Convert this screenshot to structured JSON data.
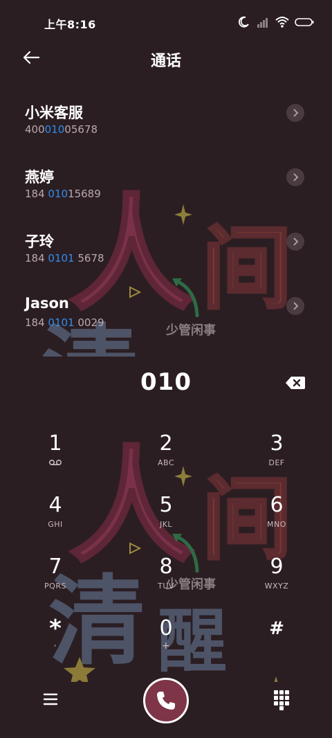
{
  "status_bar": {
    "time": "上午8:16",
    "icons": [
      "moon-icon",
      "signal-icon",
      "wifi-icon",
      "battery-icon"
    ]
  },
  "header": {
    "title": "通话",
    "back_icon": "back-arrow-icon"
  },
  "contacts": [
    {
      "name": "小米客服",
      "number_pre": "400",
      "number_match": "010",
      "number_post": "05678"
    },
    {
      "name": "燕婷",
      "number_pre": "184 ",
      "number_match": "010",
      "number_post": "15689"
    },
    {
      "name": "子玲",
      "number_pre": "184 ",
      "number_match": "0101",
      "number_post": " 5678"
    },
    {
      "name": "Jason",
      "number_pre": "184 ",
      "number_match": "0101",
      "number_post": " 0029"
    }
  ],
  "dialed_number": "010",
  "keypad": [
    {
      "digit": "1",
      "letters": ""
    },
    {
      "digit": "2",
      "letters": "ABC"
    },
    {
      "digit": "3",
      "letters": "DEF"
    },
    {
      "digit": "4",
      "letters": "GHI"
    },
    {
      "digit": "5",
      "letters": "JKL"
    },
    {
      "digit": "6",
      "letters": "MNO"
    },
    {
      "digit": "7",
      "letters": "PQRS"
    },
    {
      "digit": "8",
      "letters": "TUV"
    },
    {
      "digit": "9",
      "letters": "WXYZ"
    },
    {
      "digit": "*",
      "letters": ","
    },
    {
      "digit": "0",
      "letters": "+"
    },
    {
      "digit": "#",
      "letters": ""
    }
  ],
  "wallpaper_text": {
    "top_chars": [
      "人",
      "间",
      "清"
    ],
    "bottom_chars": [
      "人",
      "间",
      "清",
      "醒"
    ],
    "small_caption": "少管闲事"
  },
  "colors": {
    "background": "#2b1e22",
    "highlight": "#2f8df0",
    "call_button": "#7e3547"
  }
}
